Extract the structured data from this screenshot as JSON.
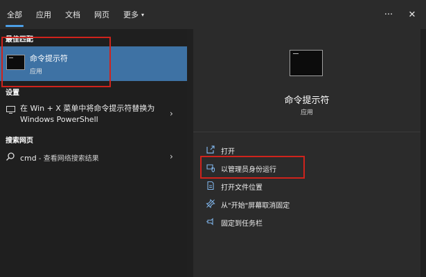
{
  "tabs": [
    {
      "label": "全部",
      "active": true
    },
    {
      "label": "应用",
      "active": false
    },
    {
      "label": "文档",
      "active": false
    },
    {
      "label": "网页",
      "active": false
    },
    {
      "label": "更多",
      "active": false
    }
  ],
  "topbar": {
    "more_caret": "▾",
    "ellipsis": "···",
    "close": "✕"
  },
  "left": {
    "best_match_title": "最佳匹配",
    "best_match": {
      "title": "命令提示符",
      "subtitle": "应用"
    },
    "settings_title": "设置",
    "settings_item": {
      "text": "在 Win + X 菜单中将命令提示符替换为 Windows PowerShell"
    },
    "web_title": "搜索网页",
    "web_item": {
      "query": "cmd",
      "suffix": " - 查看网络搜索结果"
    }
  },
  "right": {
    "app_title": "命令提示符",
    "app_type": "应用",
    "actions": [
      {
        "label": "打开",
        "icon": "open-icon"
      },
      {
        "label": "以管理员身份运行",
        "icon": "admin-shield-icon"
      },
      {
        "label": "打开文件位置",
        "icon": "file-location-icon"
      },
      {
        "label": "从\"开始\"屏幕取消固定",
        "icon": "unpin-icon"
      },
      {
        "label": "固定到任务栏",
        "icon": "pin-taskbar-icon"
      }
    ]
  },
  "colors": {
    "selection": "#3e72a4",
    "highlight_box": "#d0231c",
    "tab_underline": "#4c9fe6"
  }
}
